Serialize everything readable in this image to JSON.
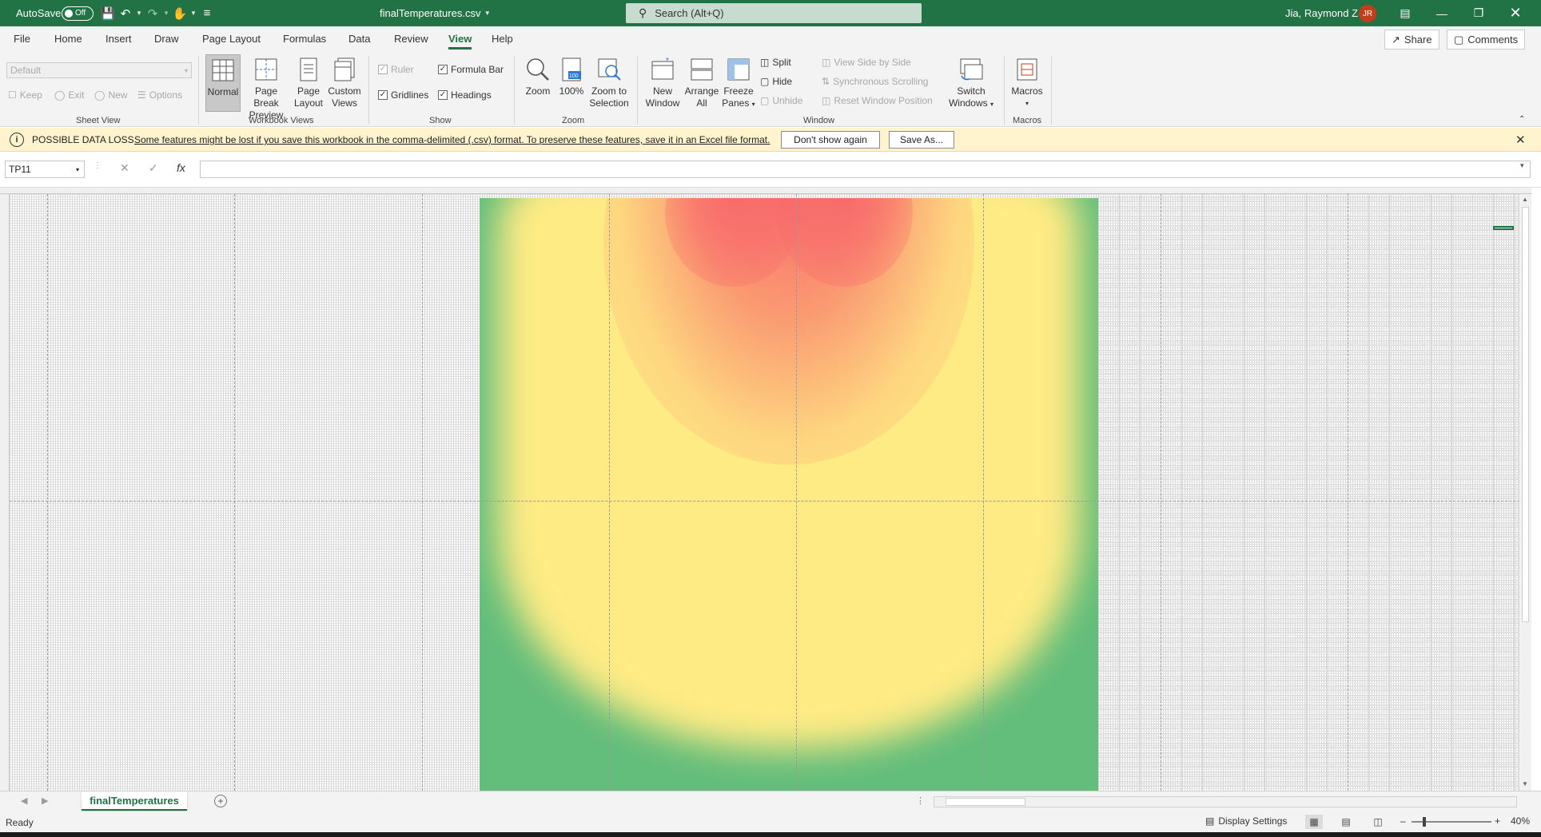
{
  "titlebar": {
    "autosave_label": "AutoSave",
    "autosave_state": "Off",
    "doc_title": "finalTemperatures.csv",
    "search_placeholder": "Search (Alt+Q)",
    "user_name": "Jia, Raymond Z",
    "user_initials": "JR"
  },
  "menu": {
    "tabs": [
      "File",
      "Home",
      "Insert",
      "Draw",
      "Page Layout",
      "Formulas",
      "Data",
      "Review",
      "View",
      "Help"
    ],
    "active_tab": "View",
    "share": "Share",
    "comments": "Comments"
  },
  "ribbon": {
    "sheet_view": {
      "select_value": "Default",
      "keep": "Keep",
      "exit": "Exit",
      "new": "New",
      "options": "Options",
      "label": "Sheet View"
    },
    "workbook_views": {
      "normal": "Normal",
      "page_break_1": "Page Break",
      "page_break_2": "Preview",
      "page_layout_1": "Page",
      "page_layout_2": "Layout",
      "custom_1": "Custom",
      "custom_2": "Views",
      "label": "Workbook Views"
    },
    "show": {
      "ruler": "Ruler",
      "formula_bar": "Formula Bar",
      "gridlines": "Gridlines",
      "headings": "Headings",
      "label": "Show"
    },
    "zoom": {
      "zoom": "Zoom",
      "hundred": "100%",
      "zoom_to_1": "Zoom to",
      "zoom_to_2": "Selection",
      "label": "Zoom"
    },
    "window": {
      "new_1": "New",
      "new_2": "Window",
      "arrange_1": "Arrange",
      "arrange_2": "All",
      "freeze_1": "Freeze",
      "freeze_2": "Panes",
      "split": "Split",
      "hide": "Hide",
      "unhide": "Unhide",
      "side_by_side": "View Side by Side",
      "sync_scroll": "Synchronous Scrolling",
      "reset_pos": "Reset Window Position",
      "switch_1": "Switch",
      "switch_2": "Windows",
      "label": "Window"
    },
    "macros": {
      "macros": "Macros",
      "label": "Macros"
    }
  },
  "message_bar": {
    "title": "POSSIBLE DATA LOSS",
    "text": "Some features might be lost if you save this workbook in the comma-delimited (.csv) format. To preserve these features, save it in an Excel file format.",
    "dont_show": "Don't show again",
    "save_as": "Save As..."
  },
  "formula_bar": {
    "name_box": "TP11",
    "formula_value": ""
  },
  "sheet": {
    "tab_name": "finalTemperatures"
  },
  "status": {
    "ready": "Ready",
    "display_settings": "Display Settings",
    "zoom_level": "40%"
  },
  "colors": {
    "accent": "#217346",
    "heat_low": "#63be7b",
    "heat_mid": "#ffeb84",
    "heat_high": "#f8696b"
  }
}
